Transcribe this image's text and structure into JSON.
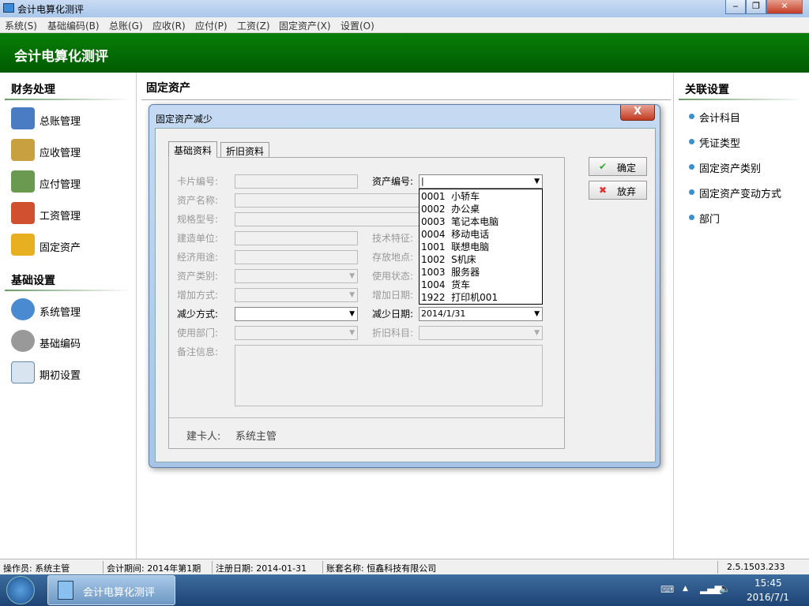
{
  "window": {
    "title": "会计电算化测评",
    "minimize": "‒",
    "restore": "❐",
    "close": "✕"
  },
  "menu": [
    "系统(S)",
    "基础编码(B)",
    "总账(G)",
    "应收(R)",
    "应付(P)",
    "工资(Z)",
    "固定资产(X)",
    "设置(O)"
  ],
  "banner": "会计电算化测评",
  "left": {
    "sections": [
      {
        "title": "财务处理",
        "items": [
          "总账管理",
          "应收管理",
          "应付管理",
          "工资管理",
          "固定资产"
        ]
      },
      {
        "title": "基础设置",
        "items": [
          "系统管理",
          "基础编码",
          "期初设置"
        ]
      }
    ]
  },
  "center": {
    "title": "固定资产"
  },
  "right": {
    "title": "关联设置",
    "items": [
      "会计科目",
      "凭证类型",
      "固定资产类别",
      "固定资产变动方式",
      "部门"
    ]
  },
  "dialog": {
    "title": "固定资产减少",
    "close": "X",
    "tabs": [
      "基础资料",
      "折旧资料"
    ],
    "fields": {
      "card_no": "卡片编号:",
      "asset_no": "资产编号:",
      "asset_name": "资产名称:",
      "spec": "规格型号:",
      "builder": "建造单位:",
      "tech": "技术特征:",
      "usage": "经济用途:",
      "location": "存放地点:",
      "category": "资产类别:",
      "status": "使用状态:",
      "add_method": "增加方式:",
      "add_date": "增加日期:",
      "reduce_method": "减少方式:",
      "reduce_date": "减少日期:",
      "dept": "使用部门:",
      "depr_account": "折旧科目:",
      "remark": "备注信息:"
    },
    "reduce_date_value": "2014/1/31",
    "creator_label": "建卡人:",
    "creator": "系统主管",
    "ok": "确定",
    "cancel": "放弃",
    "dropdown": [
      "0001  小轿车",
      "0002  办公桌",
      "0003  笔记本电脑",
      "0004  移动电话",
      "1001  联想电脑",
      "1002  S机床",
      "1003  服务器",
      "1004  货车",
      "1922  打印机001"
    ]
  },
  "status": {
    "operator": "操作员: 系统主管",
    "period": "会计期间: 2014年第1期",
    "reg_date": "注册日期: 2014-01-31",
    "account": "账套名称: 恒鑫科技有限公司",
    "version": "2.5.1503.233"
  },
  "taskbar": {
    "app": "会计电算化测评",
    "time": "15:45",
    "date": "2016/7/1"
  }
}
